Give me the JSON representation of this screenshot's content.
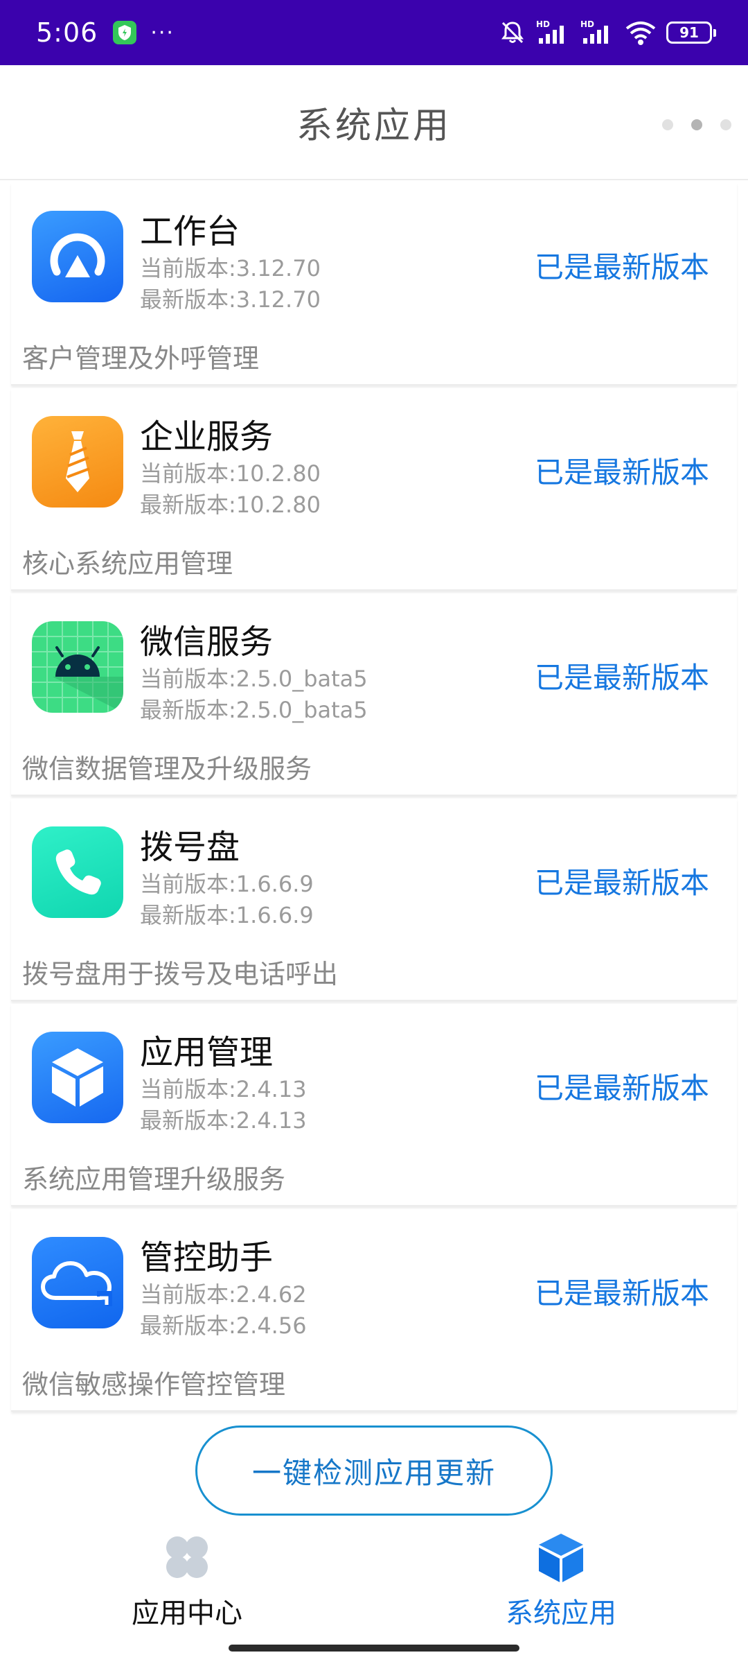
{
  "status_bar": {
    "time": "5:06",
    "more": "···",
    "battery": "91",
    "signal_label_1": "HD",
    "signal_label_2": "HD"
  },
  "header": {
    "title": "系统应用"
  },
  "apps": [
    {
      "name": "工作台",
      "current": "当前版本:3.12.70",
      "latest": "最新版本:3.12.70",
      "status": "已是最新版本",
      "desc": "客户管理及外呼管理",
      "icon": "workbench-icon"
    },
    {
      "name": "企业服务",
      "current": "当前版本:10.2.80",
      "latest": "最新版本:10.2.80",
      "status": "已是最新版本",
      "desc": "核心系统应用管理",
      "icon": "tie-icon"
    },
    {
      "name": "微信服务",
      "current": "当前版本:2.5.0_bata5",
      "latest": "最新版本:2.5.0_bata5",
      "status": "已是最新版本",
      "desc": "微信数据管理及升级服务",
      "icon": "android-icon"
    },
    {
      "name": "拨号盘",
      "current": "当前版本:1.6.6.9",
      "latest": "最新版本:1.6.6.9",
      "status": "已是最新版本",
      "desc": "拨号盘用于拨号及电话呼出",
      "icon": "phone-icon"
    },
    {
      "name": "应用管理",
      "current": "当前版本:2.4.13",
      "latest": "最新版本:2.4.13",
      "status": "已是最新版本",
      "desc": "系统应用管理升级服务",
      "icon": "cube-icon"
    },
    {
      "name": "管控助手",
      "current": "当前版本:2.4.62",
      "latest": "最新版本:2.4.56",
      "status": "已是最新版本",
      "desc": "微信敏感操作管控管理",
      "icon": "cloud-icon"
    }
  ],
  "check_button": {
    "label": "一键检测应用更新"
  },
  "bottom_nav": {
    "items": [
      {
        "label": "应用中心",
        "icon": "app-center-icon",
        "active": false
      },
      {
        "label": "系统应用",
        "icon": "system-apps-cube-icon",
        "active": true
      }
    ]
  },
  "colors": {
    "status_bar": "#3b02ad",
    "accent": "#1677e0",
    "button_border": "#1890d0"
  }
}
